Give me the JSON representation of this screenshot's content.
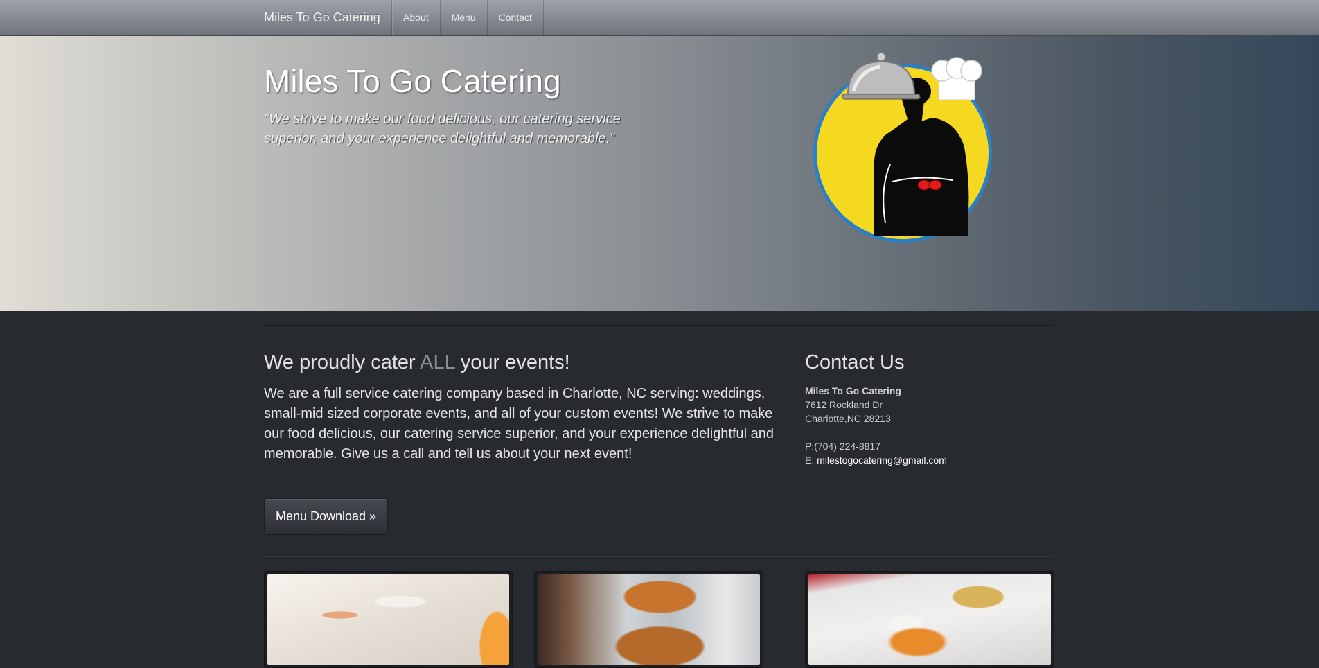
{
  "nav": {
    "brand": "Miles To Go Catering",
    "links": [
      {
        "label": "About"
      },
      {
        "label": "Menu"
      },
      {
        "label": "Contact"
      }
    ]
  },
  "hero": {
    "title": "Miles To Go Catering",
    "quote": "\"We strive to make our food delicious, our catering service superior, and your experience delightful and memorable.\"",
    "logo_icon": "chef-car-logo-icon"
  },
  "main": {
    "heading_pre": "We proudly cater ",
    "heading_accent": "ALL",
    "heading_post": " your events!",
    "body": "We are a full service catering company based in Charlotte, NC serving: weddings, small-mid sized corporate events, and all of your custom events! We strive to make our food delicious, our catering service superior, and your experience delightful and memorable. Give us a call and tell us about your next event!",
    "button_label": "Menu Download »"
  },
  "contact": {
    "heading": "Contact Us",
    "company": "Miles To Go Catering",
    "street": "7612 Rockland Dr",
    "city": "Charlotte,NC 28213",
    "phone_label": "P:",
    "phone": "(704) 224-8817",
    "email_label": "E:",
    "email": "milestogocatering@gmail.com"
  },
  "colors": {
    "background": "#272b30",
    "navbar": "#8a8f96",
    "logo_yellow": "#f5d820",
    "logo_ring": "#2a7fc9"
  }
}
